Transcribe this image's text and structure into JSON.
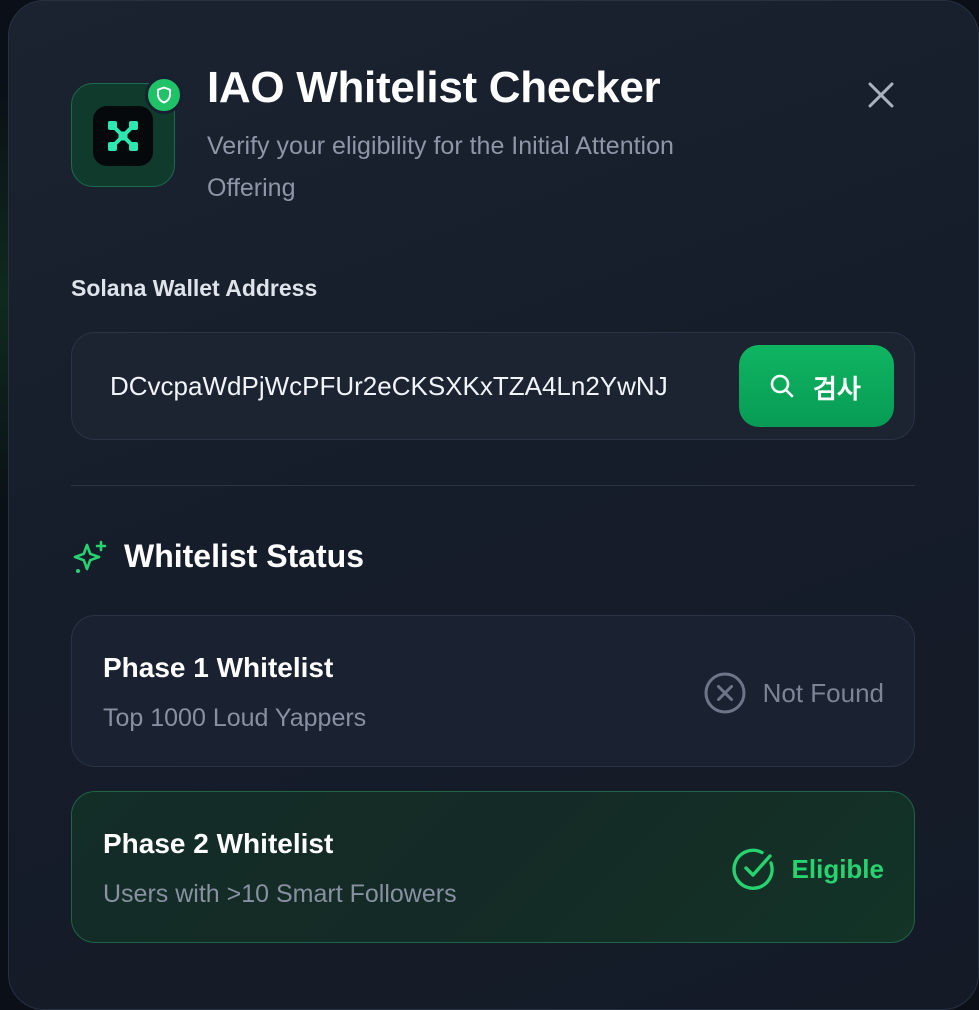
{
  "modal": {
    "title": "IAO Whitelist Checker",
    "subtitle": "Verify your eligibility for the Initial Attention Offering",
    "logo_icon": "x-logo-icon",
    "badge_icon": "shield-icon",
    "close_icon": "close-icon"
  },
  "wallet": {
    "label": "Solana Wallet Address",
    "value": "DCvcpaWdPjWcPFUr2eCKSXKxTZA4Ln2YwNJ",
    "search_label": "검사",
    "search_icon": "search-icon"
  },
  "status": {
    "heading": "Whitelist Status",
    "heading_icon": "sparkle-icon",
    "phases": [
      {
        "title": "Phase 1 Whitelist",
        "description": "Top 1000 Loud Yappers",
        "result": "Not Found",
        "result_icon": "x-circle-icon",
        "result_color": "#7c8596"
      },
      {
        "title": "Phase 2 Whitelist",
        "description": "Users with >10 Smart Followers",
        "result": "Eligible",
        "result_icon": "check-circle-icon",
        "result_color": "#27d36f"
      }
    ]
  },
  "colors": {
    "accent": "#10b460",
    "background": "#161d2a"
  }
}
